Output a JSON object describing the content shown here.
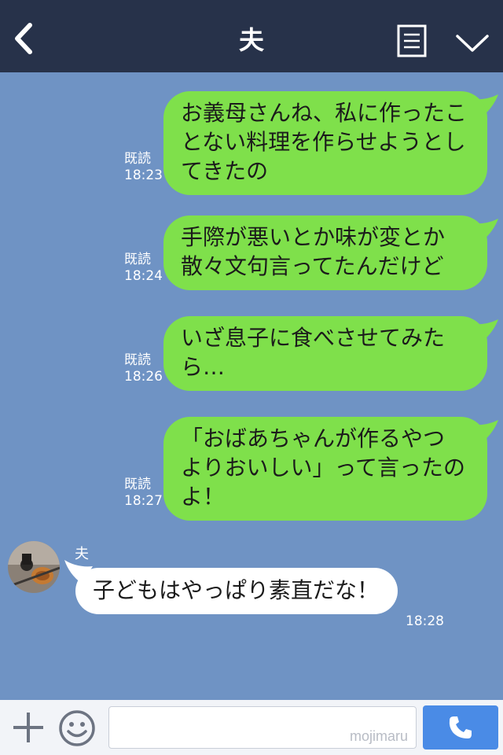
{
  "header": {
    "title": "夫",
    "back_icon": "chevron-left-icon",
    "menu_icon": "note-menu-icon",
    "more_icon": "chevron-down-icon"
  },
  "messages": [
    {
      "text": "お義母さんね、私に作ったことない料理を作らせようとしてきたの",
      "read": "既読",
      "time": "18:23"
    },
    {
      "text": "手際が悪いとか味が変とか散々文句言ってたんだけど",
      "read": "既読",
      "time": "18:24"
    },
    {
      "text": "いざ息子に食べさせてみたら…",
      "read": "既読",
      "time": "18:26"
    },
    {
      "text": "「おばあちゃんが作るやつよりおいしい」って言ったのよ！",
      "read": "既読",
      "time": "18:27"
    }
  ],
  "incoming": {
    "sender": "夫",
    "text": "子どもはやっぱり素直だな！",
    "time": "18:28"
  },
  "bottom": {
    "watermark": "mojimaru",
    "plus_icon": "plus-icon",
    "emoji_icon": "smiley-icon",
    "call_icon": "phone-icon"
  },
  "colors": {
    "header_bg": "#27324a",
    "chat_bg": "#6f93c4",
    "outgoing_bubble": "#7fe04b",
    "incoming_bubble": "#ffffff",
    "call_button": "#4a8be6"
  }
}
